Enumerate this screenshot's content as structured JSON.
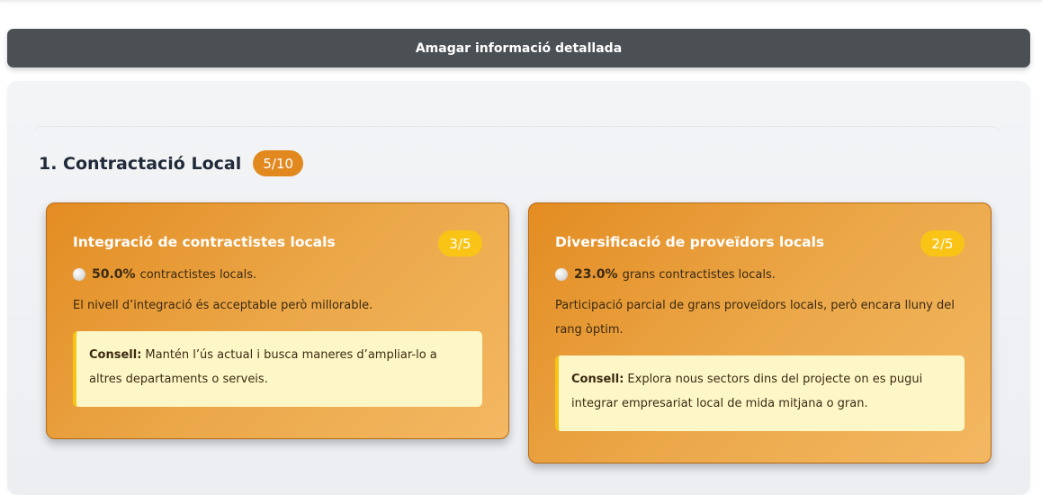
{
  "toggle": {
    "label": "Amagar informació detallada"
  },
  "section": {
    "title": "1. Contractació Local",
    "score": "5/10"
  },
  "cards": [
    {
      "title": "Integració de contractistes locals",
      "score": "3/5",
      "metric_value": "50.0%",
      "metric_label": "contractistes locals.",
      "description": "El nivell d’integració és acceptable però millorable.",
      "tip_label": "Consell:",
      "tip_text": "Mantén l’ús actual i busca maneres d’ampliar-lo a altres departaments o serveis."
    },
    {
      "title": "Diversificació de proveïdors locals",
      "score": "2/5",
      "metric_value": "23.0%",
      "metric_label": "grans contractistes locals.",
      "description": "Participació parcial de grans proveïdors locals, però encara lluny del rang òptim.",
      "tip_label": "Consell:",
      "tip_text": "Explora nous sectors dins del projecte on es pugui integrar empresariat local de mida mitjana o gran."
    }
  ],
  "colors": {
    "card_gradient_start": "#e38c22",
    "card_gradient_end": "#f3b862",
    "score_badge": "#f9c416",
    "section_badge": "#e1891f",
    "tip_background": "#fdf7c7",
    "tip_border": "#f5c518",
    "toggle_background": "#4b5055"
  },
  "icons": {
    "metric": "circle-indicator-icon"
  }
}
